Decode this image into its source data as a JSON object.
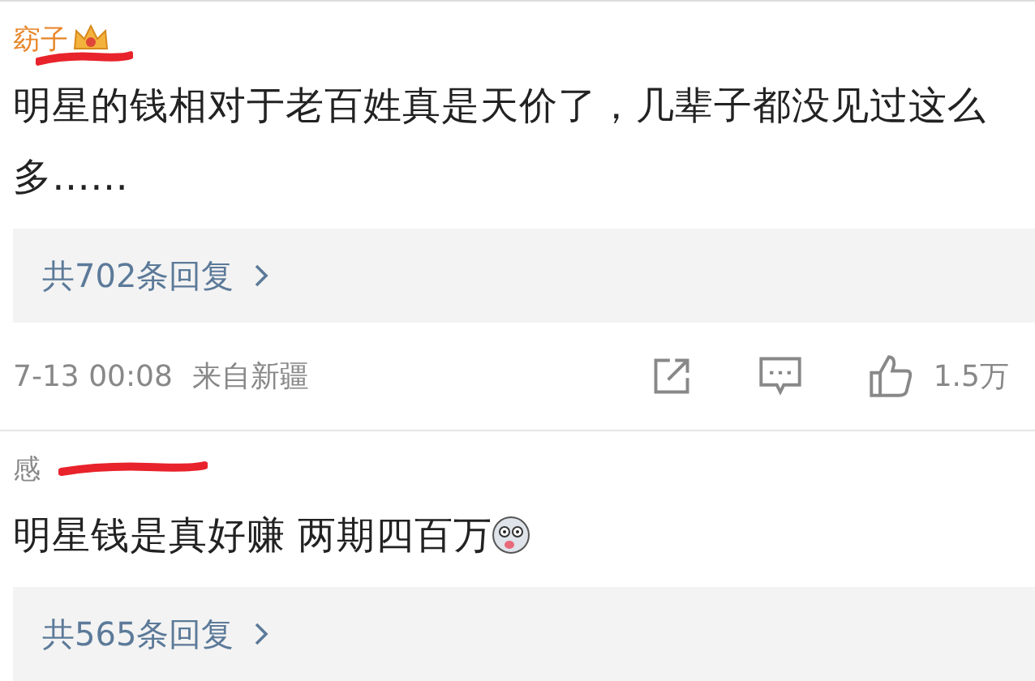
{
  "comments": [
    {
      "username": "窈子",
      "crown_badge": true,
      "text": "明星的钱相对于老百姓真是天价了，几辈子都没见过这么多……",
      "emoji": false,
      "replies": "共702条回复",
      "time": "7-13 00:08",
      "location": "来自新疆",
      "likes": "1.5万"
    },
    {
      "username": "感",
      "crown_badge": false,
      "text": "明星钱是真好赚  两期四百万",
      "emoji": true,
      "replies": "共565条回复"
    }
  ]
}
